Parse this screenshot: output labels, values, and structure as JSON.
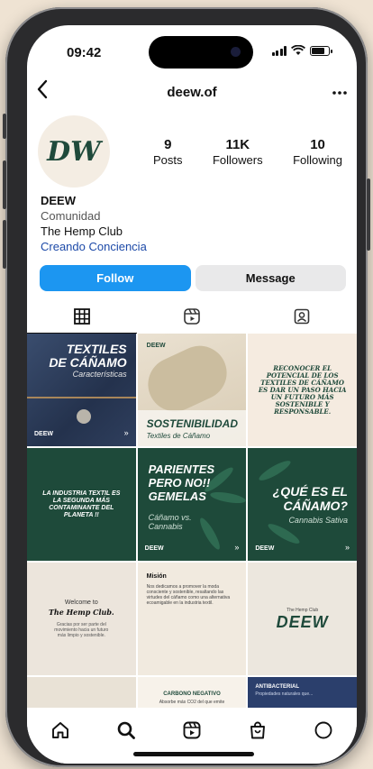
{
  "status_bar": {
    "time": "09:42"
  },
  "header": {
    "username": "deew.of",
    "back_icon": "chevron-left-icon",
    "more_icon": "ellipsis-icon"
  },
  "profile": {
    "avatar_text": "DW",
    "stats": [
      {
        "value": "9",
        "label": "Posts"
      },
      {
        "value": "11K",
        "label": "Followers"
      },
      {
        "value": "10",
        "label": "Following"
      }
    ],
    "name": "DEEW",
    "category": "Comunidad",
    "bio_line": "The Hemp Club",
    "bio_link": "Creando Conciencia"
  },
  "buttons": {
    "follow": "Follow",
    "message": "Message"
  },
  "tabs": [
    "grid-icon",
    "reels-icon",
    "tagged-icon"
  ],
  "posts": {
    "p1": {
      "title": "TEXTILES DE CÁÑAMO",
      "subtitle": "Características",
      "logo": "DEEW"
    },
    "p2": {
      "title": "SOSTENIBILIDAD",
      "subtitle": "Textiles de Cáñamo",
      "logo": "DEEW"
    },
    "p3": {
      "text": "RECONOCER EL POTENCIAL DE LOS TEXTILES DE CÁÑAMO ES DAR UN PASO HACIA UN FUTURO MÁS SOSTENIBLE Y RESPONSABLE."
    },
    "p4": {
      "text": "LA INDUSTRIA TEXTIL ES LA SEGUNDA MÁS CONTAMINANTE DEL PLANETA !!"
    },
    "p5": {
      "title": "PARIENTES PERO NO!! GEMELAS",
      "subtitle": "Cáñamo vs. Cannabis",
      "logo": "DEEW"
    },
    "p6": {
      "title": "¿QUÉ ES EL CÁÑAMO?",
      "subtitle": "Cannabis Sativa",
      "logo": "DEEW"
    },
    "p7": {
      "line1": "Welcome to",
      "line2": "The Hemp Club.",
      "line3": "Gracias por ser parte del movimiento hacia un futuro más limpio y sostenible."
    },
    "p8": {
      "title": "Misión",
      "text": "Nos dedicamos a promover la moda consciente y sostenible, resaltando las virtudes del cáñamo como una alternativa ecoamigable en la industria textil."
    },
    "p9": {
      "small": "The Hemp Club",
      "big": "DEEW"
    },
    "p11": {
      "title": "CARBONO NEGATIVO",
      "text": "Absorbe más CO2 del que emite"
    },
    "p12": {
      "title": "ANTIBACTERIAL",
      "text": "Propiedades naturales que..."
    }
  },
  "bottom_nav": [
    "home-icon",
    "search-icon",
    "reels-icon",
    "shop-icon",
    "profile-icon"
  ]
}
